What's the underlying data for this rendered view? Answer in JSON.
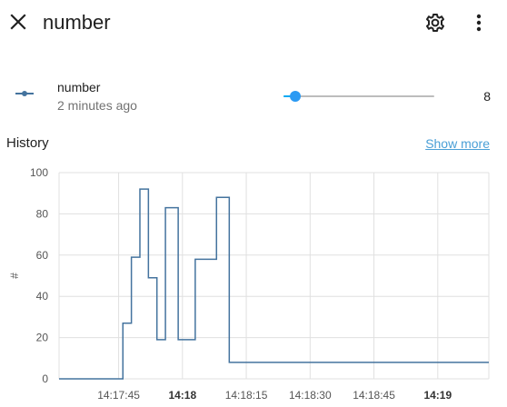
{
  "header": {
    "title": "number",
    "close_icon": "close-icon",
    "settings_icon": "gear-icon",
    "menu_icon": "more-vertical-icon"
  },
  "entity": {
    "name": "number",
    "last_changed": "2 minutes ago",
    "icon": "ray-vertex-icon",
    "slider": {
      "min": 0,
      "max": 100,
      "value": 8
    },
    "value_text": "8",
    "accent_color": "#03a9f4"
  },
  "history": {
    "title": "History",
    "show_more": "Show more"
  },
  "chart_data": {
    "type": "line",
    "step": true,
    "ylabel": "#",
    "ylim": [
      0,
      100
    ],
    "yticks": [
      "0",
      "20",
      "40",
      "60",
      "80",
      "100"
    ],
    "xticks": [
      {
        "label": "14:17:45",
        "x": "14:17:45",
        "bold": false
      },
      {
        "label": "14:18",
        "x": "14:18:00",
        "bold": true
      },
      {
        "label": "14:18:15",
        "x": "14:18:15",
        "bold": false
      },
      {
        "label": "14:18:30",
        "x": "14:18:30",
        "bold": false
      },
      {
        "label": "14:18:45",
        "x": "14:18:45",
        "bold": false
      },
      {
        "label": "14:19",
        "x": "14:19:00",
        "bold": true
      }
    ],
    "xlim": [
      "14:17:31",
      "14:19:12"
    ],
    "grid": true,
    "color": "#44739e",
    "series": [
      {
        "x": [
          "14:17:31",
          "14:17:46",
          "14:17:48",
          "14:17:50",
          "14:17:52",
          "14:17:54",
          "14:17:56",
          "14:17:59",
          "14:18:03",
          "14:18:08",
          "14:18:11",
          "14:18:15",
          "14:19:12"
        ],
        "y": [
          0,
          27,
          59,
          92,
          49,
          19,
          83,
          19,
          58,
          88,
          8,
          8,
          8
        ]
      }
    ]
  }
}
